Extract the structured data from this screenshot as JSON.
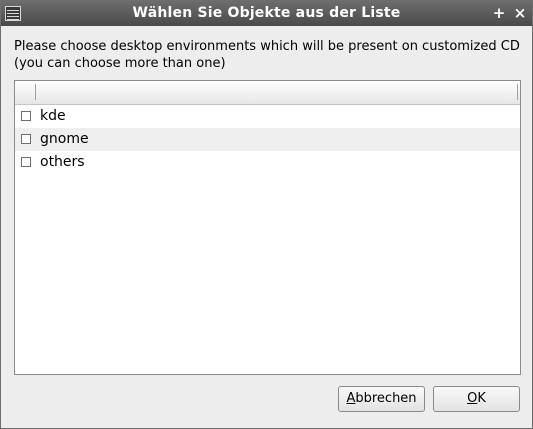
{
  "window": {
    "title": "Wählen Sie Objekte aus der Liste",
    "icon": "app-list-icon",
    "controls": {
      "plus": "+",
      "close": "×"
    }
  },
  "prompt": {
    "line1": "Please choose desktop environments which will be present on customized CD",
    "line2": "(you can choose more than one)"
  },
  "list": {
    "columns": [
      "",
      ""
    ],
    "items": [
      {
        "label": "kde",
        "checked": false
      },
      {
        "label": "gnome",
        "checked": false
      },
      {
        "label": "others",
        "checked": false
      }
    ]
  },
  "buttons": {
    "cancel": {
      "mnemonic": "A",
      "rest": "bbrechen"
    },
    "ok": {
      "mnemonic": "O",
      "rest": "K"
    }
  },
  "colors": {
    "titlebar": "#555555",
    "background": "#ededed",
    "alt_row": "#efefef"
  }
}
